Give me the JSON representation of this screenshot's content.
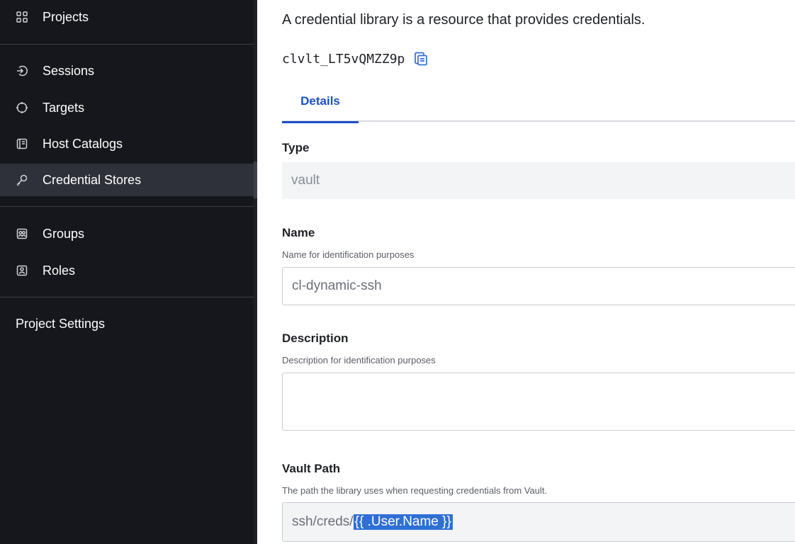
{
  "sidebar": {
    "items": [
      {
        "label": "Projects",
        "icon": "grid-icon"
      },
      {
        "label": "Sessions",
        "icon": "session-icon"
      },
      {
        "label": "Targets",
        "icon": "target-icon"
      },
      {
        "label": "Host Catalogs",
        "icon": "host-catalog-icon"
      },
      {
        "label": "Credential Stores",
        "icon": "key-icon",
        "active": true
      },
      {
        "label": "Groups",
        "icon": "groups-icon"
      },
      {
        "label": "Roles",
        "icon": "roles-icon"
      }
    ],
    "project_settings": "Project Settings"
  },
  "main": {
    "intro": "A credential library is a resource that provides credentials.",
    "resource_id": "clvlt_LT5vQMZZ9p",
    "tabs": [
      {
        "label": "Details",
        "active": true
      }
    ],
    "fields": {
      "type": {
        "label": "Type",
        "value": "vault"
      },
      "name": {
        "label": "Name",
        "helper": "Name for identification purposes",
        "value": "cl-dynamic-ssh"
      },
      "description": {
        "label": "Description",
        "helper": "Description for identification purposes",
        "value": ""
      },
      "vault_path": {
        "label": "Vault Path",
        "helper": "The path the library uses when requesting credentials from Vault.",
        "value_prefix": "ssh/creds/",
        "value_selected": "{{ .User.Name }}"
      }
    }
  },
  "colors": {
    "sidebar_bg": "#15171c",
    "active_item_bg": "#2e3139",
    "accent": "#1d4ec5",
    "selection": "#2f6fd6"
  }
}
